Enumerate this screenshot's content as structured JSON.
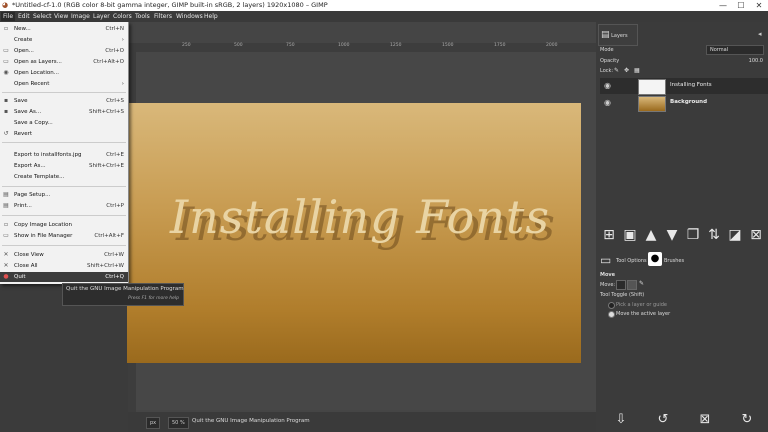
{
  "window": {
    "title": "*Untitled-cf-1.0 (RGB color 8-bit gamma integer, GIMP built-in sRGB, 2 layers) 1920x1080 – GIMP",
    "min": "—",
    "max": "☐",
    "close": "✕"
  },
  "menubar": [
    "File",
    "Edit",
    "Select",
    "View",
    "Image",
    "Layer",
    "Colors",
    "Tools",
    "Filters",
    "Windows",
    "Help"
  ],
  "file_menu": [
    {
      "label": "New...",
      "shortcut": "Ctrl+N",
      "icon": "new-icon"
    },
    {
      "label": "Create",
      "shortcut": "›",
      "icon": ""
    },
    {
      "label": "Open...",
      "shortcut": "Ctrl+O",
      "icon": "open-icon"
    },
    {
      "label": "Open as Layers...",
      "shortcut": "Ctrl+Alt+O",
      "icon": "open-layers-icon"
    },
    {
      "label": "Open Location...",
      "shortcut": "",
      "icon": "open-location-icon"
    },
    {
      "label": "Open Recent",
      "shortcut": "›",
      "icon": ""
    },
    {
      "label": "Save",
      "shortcut": "Ctrl+S",
      "icon": "save-icon"
    },
    {
      "label": "Save As...",
      "shortcut": "Shift+Ctrl+S",
      "icon": "save-as-icon"
    },
    {
      "label": "Save a Copy...",
      "shortcut": "",
      "icon": ""
    },
    {
      "label": "Revert",
      "shortcut": "",
      "icon": "revert-icon"
    },
    {
      "label": "Export to installfonts.jpg",
      "shortcut": "Ctrl+E",
      "icon": ""
    },
    {
      "label": "Export As...",
      "shortcut": "Shift+Ctrl+E",
      "icon": ""
    },
    {
      "label": "Create Template...",
      "shortcut": "",
      "icon": ""
    },
    {
      "label": "Page Setup...",
      "shortcut": "",
      "icon": "page-setup-icon"
    },
    {
      "label": "Print...",
      "shortcut": "Ctrl+P",
      "icon": "print-icon"
    },
    {
      "label": "Copy Image Location",
      "shortcut": "",
      "icon": "copy-location-icon"
    },
    {
      "label": "Show in File Manager",
      "shortcut": "Ctrl+Alt+F",
      "icon": "file-manager-icon"
    },
    {
      "label": "Close View",
      "shortcut": "Ctrl+W",
      "icon": "close-view-icon"
    },
    {
      "label": "Close All",
      "shortcut": "Shift+Ctrl+W",
      "icon": "close-all-icon"
    },
    {
      "label": "Quit",
      "shortcut": "Ctrl+Q",
      "icon": "quit-icon"
    }
  ],
  "tooltip": {
    "text": "Quit the GNU Image Manipulation Program",
    "hint": "Press F1 for more help"
  },
  "ruler_ticks": [
    "250",
    "500",
    "750",
    "1000",
    "1250",
    "1500",
    "1750",
    "2000"
  ],
  "canvas_text": "Installing Fonts",
  "status": {
    "unit": "px",
    "zoom": "50 %",
    "message": "Quit the GNU Image Manipulation Program"
  },
  "layers_panel": {
    "tab": "Layers",
    "mode_label": "Mode",
    "mode_value": "Normal",
    "opacity_label": "Opacity",
    "opacity_value": "100.0",
    "lock_label": "Lock:",
    "layers": [
      {
        "name": "Installing Fonts",
        "thumb": "text"
      },
      {
        "name": "Background",
        "thumb": "gradient"
      }
    ]
  },
  "tool_options": {
    "tab1": "Tool Options",
    "tab2": "Brushes",
    "title": "Move",
    "move_label": "Move:",
    "toggle_label": "Tool Toggle  (Shift)",
    "opt1": "Pick a layer or guide",
    "opt2": "Move the active layer"
  },
  "colors": {
    "accent": "#3c3c3c",
    "image_top": "#d9b87a",
    "image_bottom": "#9a6a1d"
  }
}
